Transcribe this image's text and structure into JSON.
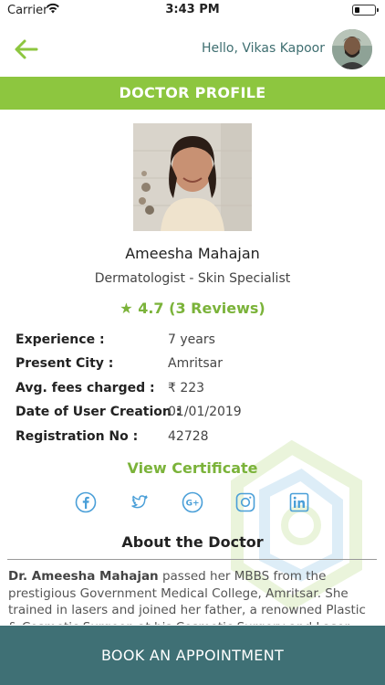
{
  "status_bar": {
    "carrier": "Carrier",
    "time": "3:43 PM",
    "battery_level": 0.25
  },
  "header": {
    "greeting": "Hello, Vikas Kapoor",
    "back_icon": "arrow-left-icon",
    "accent_color": "#8dc63f"
  },
  "page_title": "DOCTOR PROFILE",
  "doctor": {
    "name": "Ameesha Mahajan",
    "specialization": "Dermatologist - Skin Specialist",
    "rating": "★ 4.7 (3 Reviews)"
  },
  "info": [
    {
      "label": "Experience :",
      "value": "7 years"
    },
    {
      "label": "Present City :",
      "value": "Amritsar"
    },
    {
      "label": "Avg. fees charged :",
      "value": "₹ 223"
    },
    {
      "label": "Date of User Creation :",
      "value": "01/01/2019"
    },
    {
      "label": "Registration No :",
      "value": "42728"
    }
  ],
  "view_certificate": "View Certificate",
  "social_icons": [
    "facebook-icon",
    "twitter-icon",
    "google-plus-icon",
    "instagram-icon",
    "linkedin-icon"
  ],
  "about": {
    "title": "About the Doctor",
    "name_bold": "Dr. Ameesha Mahajan",
    "text": " passed her MBBS from the prestigious Government Medical College, Amritsar. She trained in lasers and joined her father, a renowned Plastic & Cosmetic Surgeon at his Cosmetic Surgery and Laser Clinic."
  },
  "book_button": "BOOK AN APPOINTMENT",
  "colors": {
    "primary_green": "#8dc63f",
    "teal": "#3f7075",
    "social_blue": "#4a9fd8"
  }
}
